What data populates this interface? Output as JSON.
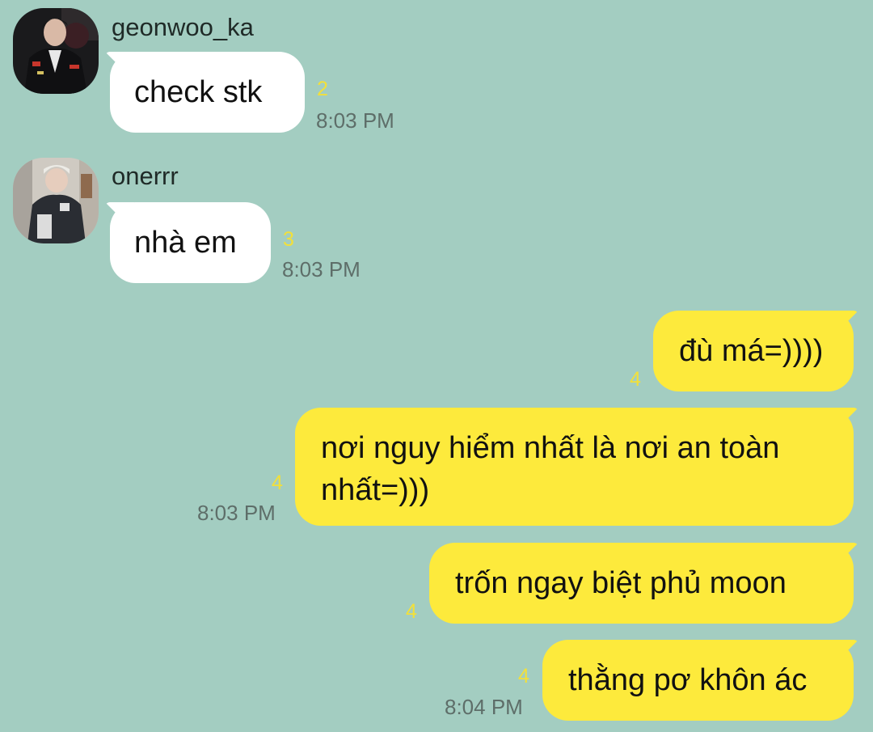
{
  "colors": {
    "background": "#a3cdc1",
    "incoming_bubble": "#ffffff",
    "outgoing_bubble": "#fdea3c",
    "unread_count": "#f2e03a",
    "timestamp": "#5e6e69"
  },
  "messages": [
    {
      "sender": "geonwoo_ka",
      "text": "check stk",
      "unread": "2",
      "time": "8:03 PM",
      "avatar": "profile-photo-geonwoo_ka"
    },
    {
      "sender": "onerrr",
      "text": "nhà em",
      "unread": "3",
      "time": "8:03 PM",
      "avatar": "profile-photo-onerrr"
    },
    {
      "text": "đù má=))))",
      "unread": "4"
    },
    {
      "text": "nơi nguy hiểm nhất là nơi an toàn nhất=)))",
      "unread": "4",
      "time": "8:03 PM"
    },
    {
      "text": "trốn ngay biệt phủ moon",
      "unread": "4"
    },
    {
      "text": "thằng pơ khôn ác",
      "unread": "4",
      "time": "8:04 PM"
    }
  ]
}
